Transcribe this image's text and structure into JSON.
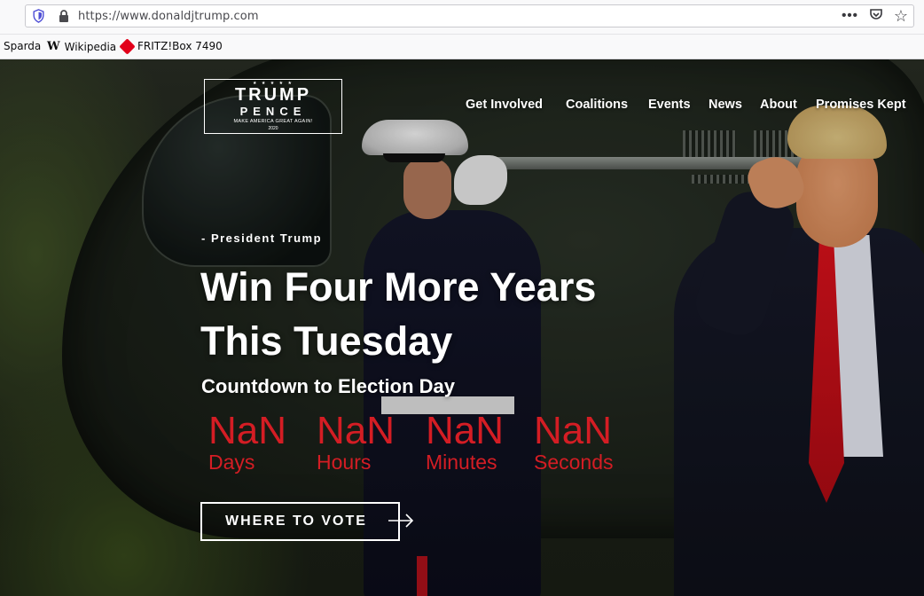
{
  "browser": {
    "url": "https://www.donaldjtrump.com",
    "bookmarks": [
      {
        "label": "Sparda",
        "icon": ""
      },
      {
        "label": "Wikipedia",
        "icon": "W"
      },
      {
        "label": "FRITZ!Box 7490",
        "icon": "fritz-icon"
      }
    ],
    "actions": {
      "more": "•••",
      "pocket": "pocket-icon",
      "star": "☆"
    }
  },
  "site": {
    "logo": {
      "stars": "★ ★ ★ ★ ★",
      "line1": "TRUMP",
      "line2": "PENCE",
      "tagline": "MAKE AMERICA GREAT AGAIN!",
      "year": "2020"
    },
    "nav": [
      "Get Involved",
      "Coalitions",
      "Events",
      "News",
      "About",
      "Promises Kept"
    ]
  },
  "hero": {
    "attribution": "- President Trump",
    "headline_line1": "Win Four More Years",
    "headline_line2": "This Tuesday",
    "countdown_title": "Countdown to Election Day",
    "countdown": [
      {
        "value": "NaN",
        "label": "Days"
      },
      {
        "value": "NaN",
        "label": "Hours"
      },
      {
        "value": "NaN",
        "label": "Minutes"
      },
      {
        "value": "NaN",
        "label": "Seconds"
      }
    ],
    "cta": "WHERE TO VOTE"
  },
  "colors": {
    "countdown": "#d41d24",
    "text": "#ffffff"
  }
}
